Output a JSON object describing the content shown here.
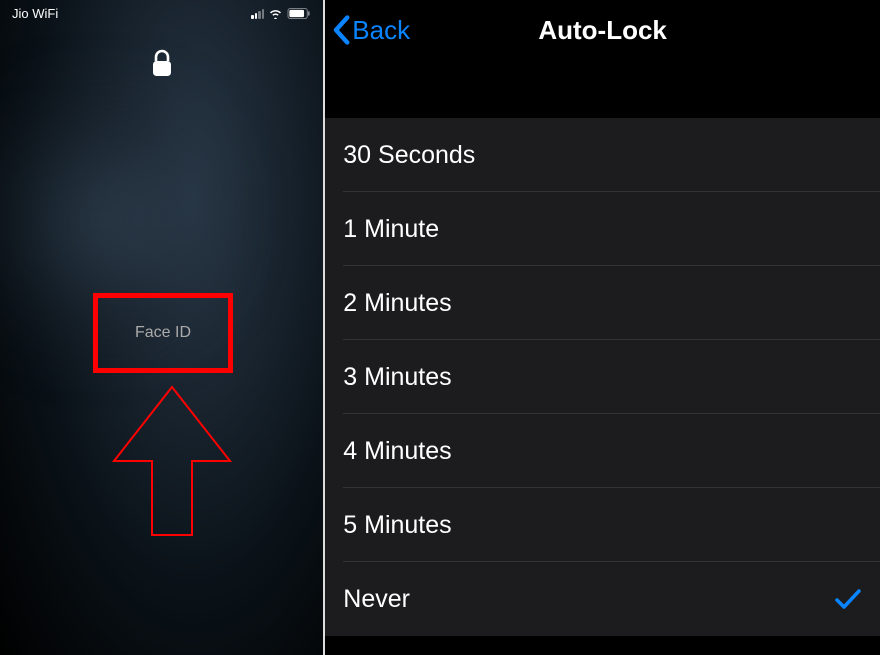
{
  "left": {
    "statusbar": {
      "carrier": "Jio WiFi"
    },
    "face_id_label": "Face ID",
    "annotation_color": "#ff0000"
  },
  "right": {
    "back_label": "Back",
    "title": "Auto-Lock",
    "options": [
      {
        "label": "30 Seconds",
        "selected": false
      },
      {
        "label": "1 Minute",
        "selected": false
      },
      {
        "label": "2 Minutes",
        "selected": false
      },
      {
        "label": "3 Minutes",
        "selected": false
      },
      {
        "label": "4 Minutes",
        "selected": false
      },
      {
        "label": "5 Minutes",
        "selected": false
      },
      {
        "label": "Never",
        "selected": true
      }
    ]
  },
  "colors": {
    "ios_blue": "#0a84ff",
    "row_bg": "#1c1c1e"
  }
}
